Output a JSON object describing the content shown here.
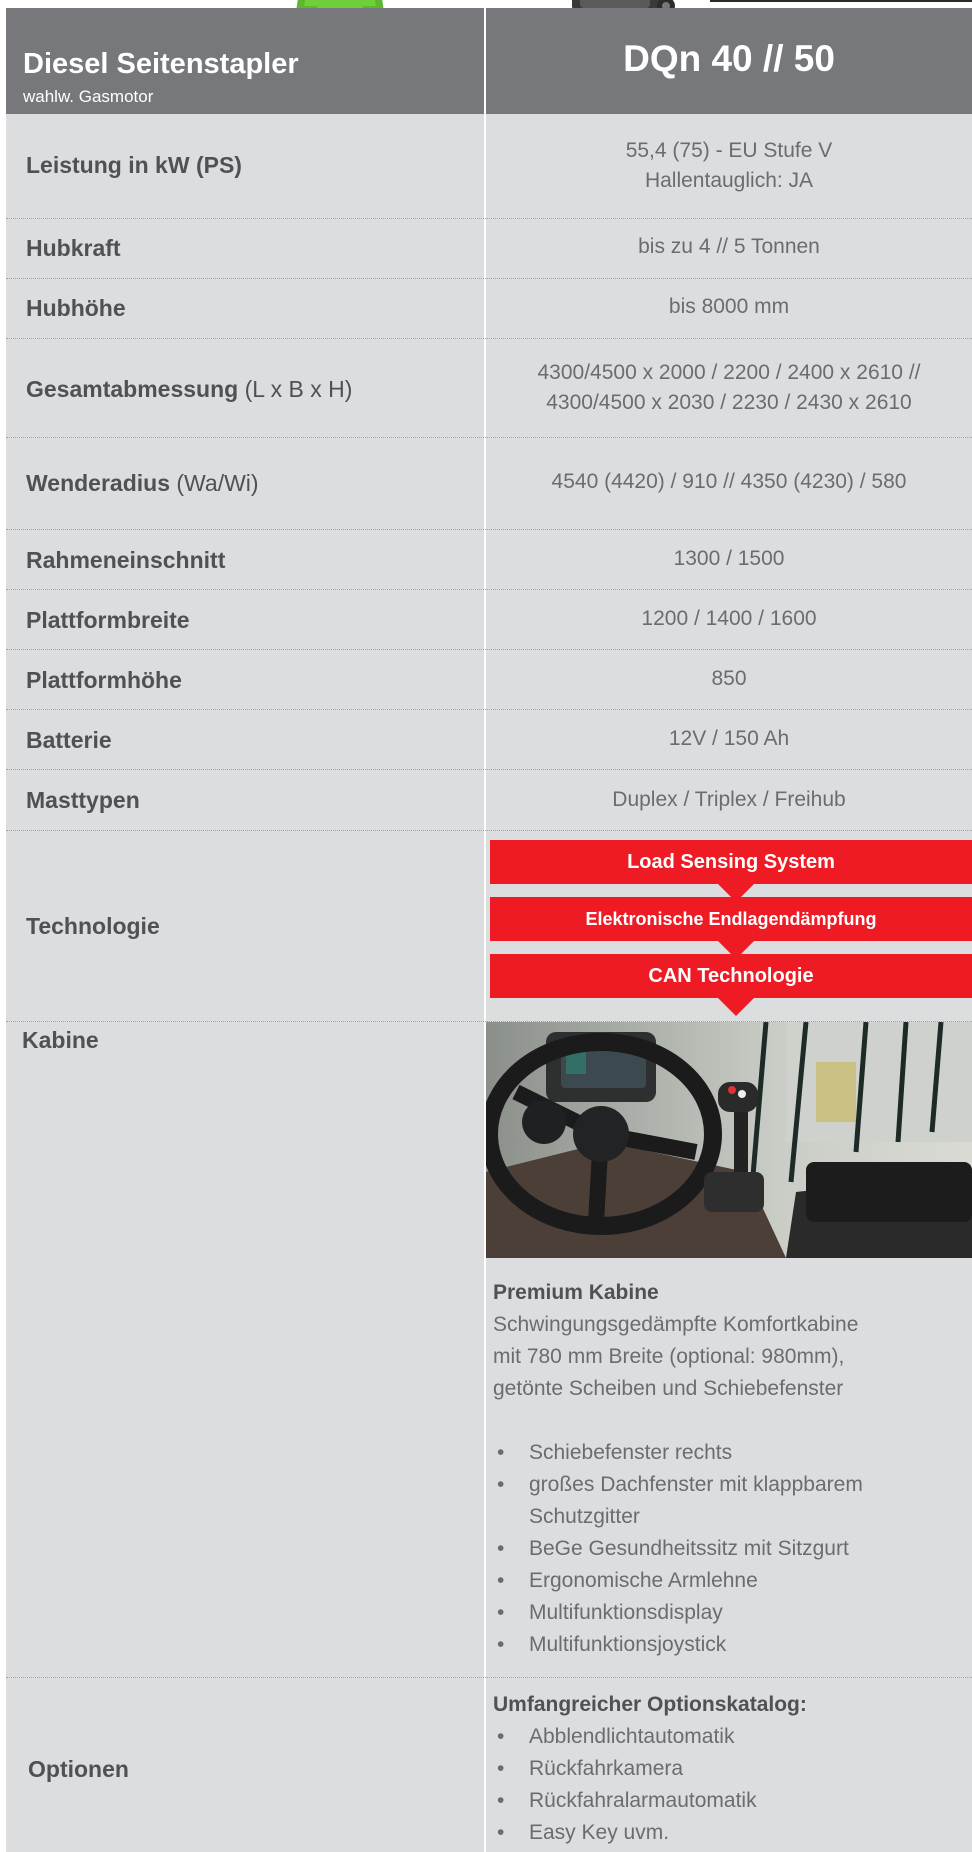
{
  "header": {
    "title": "Diesel Seitenstapler",
    "subtitle": "wahlw. Gasmotor",
    "model": "DQn 40 // 50"
  },
  "rows": [
    {
      "label": "Leistung in kW (PS)",
      "suffix": "",
      "values": [
        "55,4 (75) - EU Stufe V",
        "Hallentauglich: JA"
      ]
    },
    {
      "label": "Hubkraft",
      "suffix": "",
      "values": [
        "bis zu 4 // 5 Tonnen"
      ]
    },
    {
      "label": "Hubhöhe",
      "suffix": "",
      "values": [
        "bis 8000 mm"
      ]
    },
    {
      "label": "Gesamtabmessung",
      "suffix": " (L x B x H)",
      "values": [
        "4300/4500 x 2000 / 2200 / 2400 x 2610 //",
        "4300/4500 x 2030 / 2230 / 2430 x 2610"
      ]
    },
    {
      "label": "Wenderadius",
      "suffix": " (Wa/Wi)",
      "values": [
        "4540 (4420) / 910 // 4350 (4230) / 580"
      ]
    },
    {
      "label": "Rahmeneinschnitt",
      "suffix": "",
      "values": [
        "1300 / 1500"
      ]
    },
    {
      "label": "Plattformbreite",
      "suffix": "",
      "values": [
        "1200 / 1400 / 1600"
      ]
    },
    {
      "label": "Plattformhöhe",
      "suffix": "",
      "values": [
        "850"
      ]
    },
    {
      "label": "Batterie",
      "suffix": "",
      "values": [
        "12V / 150 Ah"
      ]
    },
    {
      "label": "Masttypen",
      "suffix": "",
      "values": [
        "Duplex / Triplex / Freihub"
      ]
    }
  ],
  "technologie": {
    "label": "Technologie",
    "items": [
      "Load Sensing System",
      "Elektronische Endlagendämpfung",
      "CAN Technologie"
    ],
    "color": "#ee1b24"
  },
  "kabine": {
    "label": "Kabine",
    "heading": "Premium Kabine",
    "description": [
      "Schwingungsgedämpfte Komfortkabine",
      "mit 780 mm Breite (optional: 980mm),",
      "getönte Scheiben und Schiebefenster"
    ],
    "features": [
      "Schiebefenster rechts",
      "großes Dachfenster mit klappbarem Schutzgitter",
      "BeGe Gesundheitssitz mit Sitzgurt",
      "Ergonomische Armlehne",
      "Multifunktionsdisplay",
      "Multifunktionsjoystick"
    ]
  },
  "optionen": {
    "label": "Optionen",
    "heading": "Umfangreicher Optionskatalog:",
    "items": [
      "Abblendlichtautomatik",
      "Rückfahrkamera",
      "Rückfahralarmautomatik",
      "Easy Key uvm."
    ]
  },
  "colors": {
    "header_bg": "#77787b",
    "sheet_bg": "#dcdddf",
    "accent_red": "#ee1b24",
    "badge_green": "#5cb82e"
  }
}
